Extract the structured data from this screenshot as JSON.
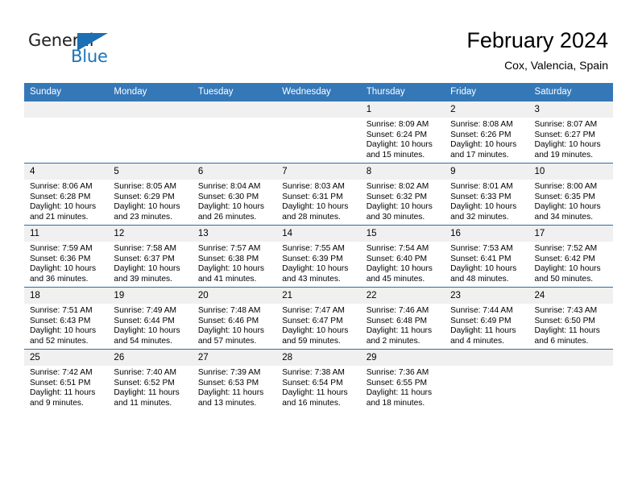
{
  "brand": {
    "name_part1": "General",
    "name_part2": "Blue",
    "triangle_icon": "triangle-icon",
    "accent_color": "#1b75bb"
  },
  "header": {
    "title": "February 2024",
    "location": "Cox, Valencia, Spain"
  },
  "theme": {
    "header_bg": "#3578b8",
    "row_divider": "#2e6da4",
    "daynum_bg": "#f0f0f0"
  },
  "weekday_headers": [
    "Sunday",
    "Monday",
    "Tuesday",
    "Wednesday",
    "Thursday",
    "Friday",
    "Saturday"
  ],
  "labels": {
    "sunrise_prefix": "Sunrise:",
    "sunset_prefix": "Sunset:",
    "daylight_prefix": "Daylight:"
  },
  "weeks": [
    [
      {
        "day": "",
        "empty": true
      },
      {
        "day": "",
        "empty": true
      },
      {
        "day": "",
        "empty": true
      },
      {
        "day": "",
        "empty": true
      },
      {
        "day": "1",
        "sunrise": "Sunrise: 8:09 AM",
        "sunset": "Sunset: 6:24 PM",
        "daylight1": "Daylight: 10 hours",
        "daylight2": "and 15 minutes."
      },
      {
        "day": "2",
        "sunrise": "Sunrise: 8:08 AM",
        "sunset": "Sunset: 6:26 PM",
        "daylight1": "Daylight: 10 hours",
        "daylight2": "and 17 minutes."
      },
      {
        "day": "3",
        "sunrise": "Sunrise: 8:07 AM",
        "sunset": "Sunset: 6:27 PM",
        "daylight1": "Daylight: 10 hours",
        "daylight2": "and 19 minutes."
      }
    ],
    [
      {
        "day": "4",
        "sunrise": "Sunrise: 8:06 AM",
        "sunset": "Sunset: 6:28 PM",
        "daylight1": "Daylight: 10 hours",
        "daylight2": "and 21 minutes."
      },
      {
        "day": "5",
        "sunrise": "Sunrise: 8:05 AM",
        "sunset": "Sunset: 6:29 PM",
        "daylight1": "Daylight: 10 hours",
        "daylight2": "and 23 minutes."
      },
      {
        "day": "6",
        "sunrise": "Sunrise: 8:04 AM",
        "sunset": "Sunset: 6:30 PM",
        "daylight1": "Daylight: 10 hours",
        "daylight2": "and 26 minutes."
      },
      {
        "day": "7",
        "sunrise": "Sunrise: 8:03 AM",
        "sunset": "Sunset: 6:31 PM",
        "daylight1": "Daylight: 10 hours",
        "daylight2": "and 28 minutes."
      },
      {
        "day": "8",
        "sunrise": "Sunrise: 8:02 AM",
        "sunset": "Sunset: 6:32 PM",
        "daylight1": "Daylight: 10 hours",
        "daylight2": "and 30 minutes."
      },
      {
        "day": "9",
        "sunrise": "Sunrise: 8:01 AM",
        "sunset": "Sunset: 6:33 PM",
        "daylight1": "Daylight: 10 hours",
        "daylight2": "and 32 minutes."
      },
      {
        "day": "10",
        "sunrise": "Sunrise: 8:00 AM",
        "sunset": "Sunset: 6:35 PM",
        "daylight1": "Daylight: 10 hours",
        "daylight2": "and 34 minutes."
      }
    ],
    [
      {
        "day": "11",
        "sunrise": "Sunrise: 7:59 AM",
        "sunset": "Sunset: 6:36 PM",
        "daylight1": "Daylight: 10 hours",
        "daylight2": "and 36 minutes."
      },
      {
        "day": "12",
        "sunrise": "Sunrise: 7:58 AM",
        "sunset": "Sunset: 6:37 PM",
        "daylight1": "Daylight: 10 hours",
        "daylight2": "and 39 minutes."
      },
      {
        "day": "13",
        "sunrise": "Sunrise: 7:57 AM",
        "sunset": "Sunset: 6:38 PM",
        "daylight1": "Daylight: 10 hours",
        "daylight2": "and 41 minutes."
      },
      {
        "day": "14",
        "sunrise": "Sunrise: 7:55 AM",
        "sunset": "Sunset: 6:39 PM",
        "daylight1": "Daylight: 10 hours",
        "daylight2": "and 43 minutes."
      },
      {
        "day": "15",
        "sunrise": "Sunrise: 7:54 AM",
        "sunset": "Sunset: 6:40 PM",
        "daylight1": "Daylight: 10 hours",
        "daylight2": "and 45 minutes."
      },
      {
        "day": "16",
        "sunrise": "Sunrise: 7:53 AM",
        "sunset": "Sunset: 6:41 PM",
        "daylight1": "Daylight: 10 hours",
        "daylight2": "and 48 minutes."
      },
      {
        "day": "17",
        "sunrise": "Sunrise: 7:52 AM",
        "sunset": "Sunset: 6:42 PM",
        "daylight1": "Daylight: 10 hours",
        "daylight2": "and 50 minutes."
      }
    ],
    [
      {
        "day": "18",
        "sunrise": "Sunrise: 7:51 AM",
        "sunset": "Sunset: 6:43 PM",
        "daylight1": "Daylight: 10 hours",
        "daylight2": "and 52 minutes."
      },
      {
        "day": "19",
        "sunrise": "Sunrise: 7:49 AM",
        "sunset": "Sunset: 6:44 PM",
        "daylight1": "Daylight: 10 hours",
        "daylight2": "and 54 minutes."
      },
      {
        "day": "20",
        "sunrise": "Sunrise: 7:48 AM",
        "sunset": "Sunset: 6:46 PM",
        "daylight1": "Daylight: 10 hours",
        "daylight2": "and 57 minutes."
      },
      {
        "day": "21",
        "sunrise": "Sunrise: 7:47 AM",
        "sunset": "Sunset: 6:47 PM",
        "daylight1": "Daylight: 10 hours",
        "daylight2": "and 59 minutes."
      },
      {
        "day": "22",
        "sunrise": "Sunrise: 7:46 AM",
        "sunset": "Sunset: 6:48 PM",
        "daylight1": "Daylight: 11 hours",
        "daylight2": "and 2 minutes."
      },
      {
        "day": "23",
        "sunrise": "Sunrise: 7:44 AM",
        "sunset": "Sunset: 6:49 PM",
        "daylight1": "Daylight: 11 hours",
        "daylight2": "and 4 minutes."
      },
      {
        "day": "24",
        "sunrise": "Sunrise: 7:43 AM",
        "sunset": "Sunset: 6:50 PM",
        "daylight1": "Daylight: 11 hours",
        "daylight2": "and 6 minutes."
      }
    ],
    [
      {
        "day": "25",
        "sunrise": "Sunrise: 7:42 AM",
        "sunset": "Sunset: 6:51 PM",
        "daylight1": "Daylight: 11 hours",
        "daylight2": "and 9 minutes."
      },
      {
        "day": "26",
        "sunrise": "Sunrise: 7:40 AM",
        "sunset": "Sunset: 6:52 PM",
        "daylight1": "Daylight: 11 hours",
        "daylight2": "and 11 minutes."
      },
      {
        "day": "27",
        "sunrise": "Sunrise: 7:39 AM",
        "sunset": "Sunset: 6:53 PM",
        "daylight1": "Daylight: 11 hours",
        "daylight2": "and 13 minutes."
      },
      {
        "day": "28",
        "sunrise": "Sunrise: 7:38 AM",
        "sunset": "Sunset: 6:54 PM",
        "daylight1": "Daylight: 11 hours",
        "daylight2": "and 16 minutes."
      },
      {
        "day": "29",
        "sunrise": "Sunrise: 7:36 AM",
        "sunset": "Sunset: 6:55 PM",
        "daylight1": "Daylight: 11 hours",
        "daylight2": "and 18 minutes."
      },
      {
        "day": "",
        "empty": true
      },
      {
        "day": "",
        "empty": true
      }
    ]
  ]
}
